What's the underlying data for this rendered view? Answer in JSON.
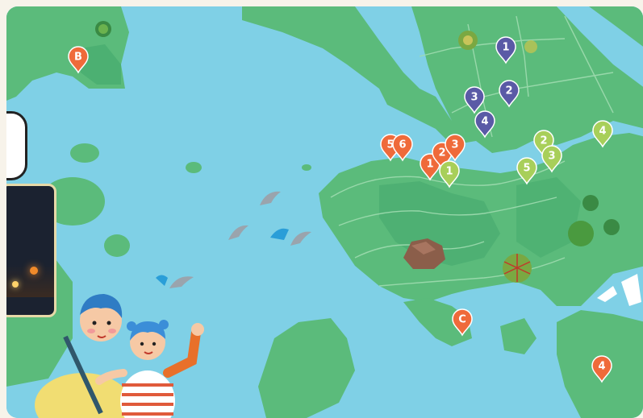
{
  "colors": {
    "sea": "#7fd0e6",
    "land": "#5bbb7b",
    "land_dark": "#3ea56a",
    "road": "#8fd1a2",
    "pin_orange": "#ef6a3a",
    "pin_purple": "#5a5aa6",
    "pin_green": "#a8cf5a",
    "dolphin": "#9aa4ad",
    "rock": "#8b5e4a"
  },
  "markers": {
    "orange": [
      {
        "label": "B"
      },
      {
        "label": "5"
      },
      {
        "label": "6"
      },
      {
        "label": "1"
      },
      {
        "label": "2"
      },
      {
        "label": "3"
      },
      {
        "label": "C"
      },
      {
        "label": "4"
      }
    ],
    "purple": [
      {
        "label": "1"
      },
      {
        "label": "2"
      },
      {
        "label": "3"
      },
      {
        "label": "4"
      }
    ],
    "green": [
      {
        "label": "1"
      },
      {
        "label": "2"
      },
      {
        "label": "3"
      },
      {
        "label": "4"
      },
      {
        "label": "5"
      }
    ]
  },
  "features": {
    "dolphin_icons": 4,
    "tree_icons": 5,
    "rock_icon": "rock-icon",
    "family_illustration": "family-illustration",
    "photo_card": "night-harbour-photo"
  }
}
